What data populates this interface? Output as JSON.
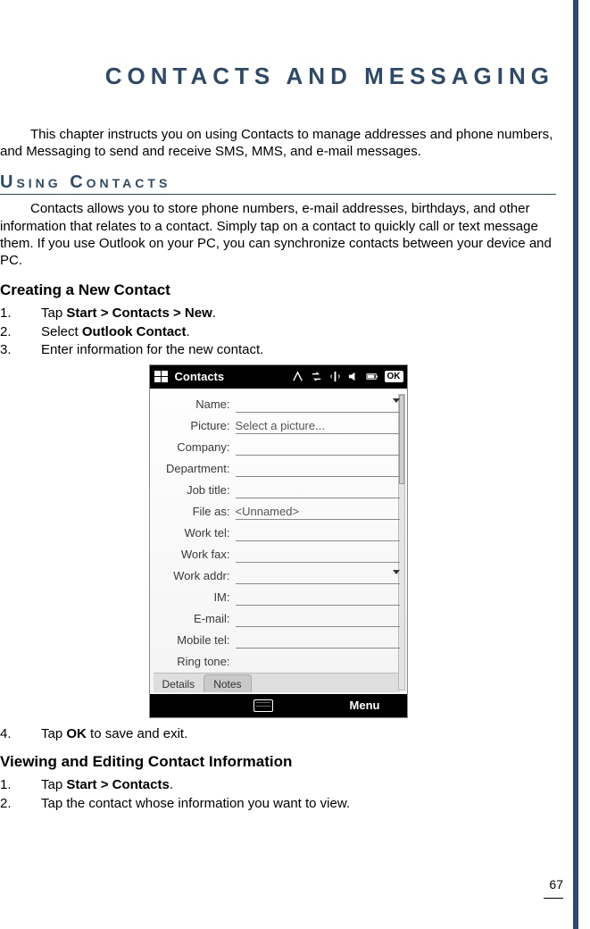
{
  "chapter": {
    "title": "Contacts and Messaging"
  },
  "intro": "This chapter instructs you on using Contacts to manage addresses and phone numbers, and Messaging to send and receive SMS, MMS, and e-mail messages.",
  "section1": {
    "heading": "Using Contacts",
    "body": "Contacts allows you to store phone numbers, e-mail addresses, birthdays, and other information that relates to a contact. Simply tap on a contact to quickly call or text message them. If you use Outlook on your PC, you can synchronize contacts between your device and PC."
  },
  "sub1": {
    "heading": "Creating a New Contact",
    "steps": [
      {
        "pre": "Tap ",
        "bold": "Start > Contacts > New",
        "post": "."
      },
      {
        "pre": "Select ",
        "bold": "Outlook Contact",
        "post": "."
      },
      {
        "pre": "Enter information for the new contact.",
        "bold": "",
        "post": ""
      }
    ],
    "steps_after": [
      {
        "pre": "Tap ",
        "bold": "OK",
        "post": " to save and exit."
      }
    ]
  },
  "sub2": {
    "heading": "Viewing and Editing Contact Information",
    "steps": [
      {
        "pre": "Tap ",
        "bold": "Start > Contacts",
        "post": "."
      },
      {
        "pre": "Tap the contact whose information you want to view.",
        "bold": "",
        "post": ""
      }
    ]
  },
  "screenshot": {
    "title": "Contacts",
    "ok": "OK",
    "fields": {
      "name": "Name:",
      "picture": "Picture:",
      "picture_val": "Select a picture...",
      "company": "Company:",
      "department": "Department:",
      "job": "Job title:",
      "fileas": "File as:",
      "fileas_val": "<Unnamed>",
      "worktel": "Work tel:",
      "workfax": "Work fax:",
      "workaddr": "Work addr:",
      "im": "IM:",
      "email": "E-mail:",
      "mobile": "Mobile tel:",
      "ringtone": "Ring tone:"
    },
    "tabs": {
      "details": "Details",
      "notes": "Notes"
    },
    "menu": "Menu"
  },
  "page_number": "67"
}
